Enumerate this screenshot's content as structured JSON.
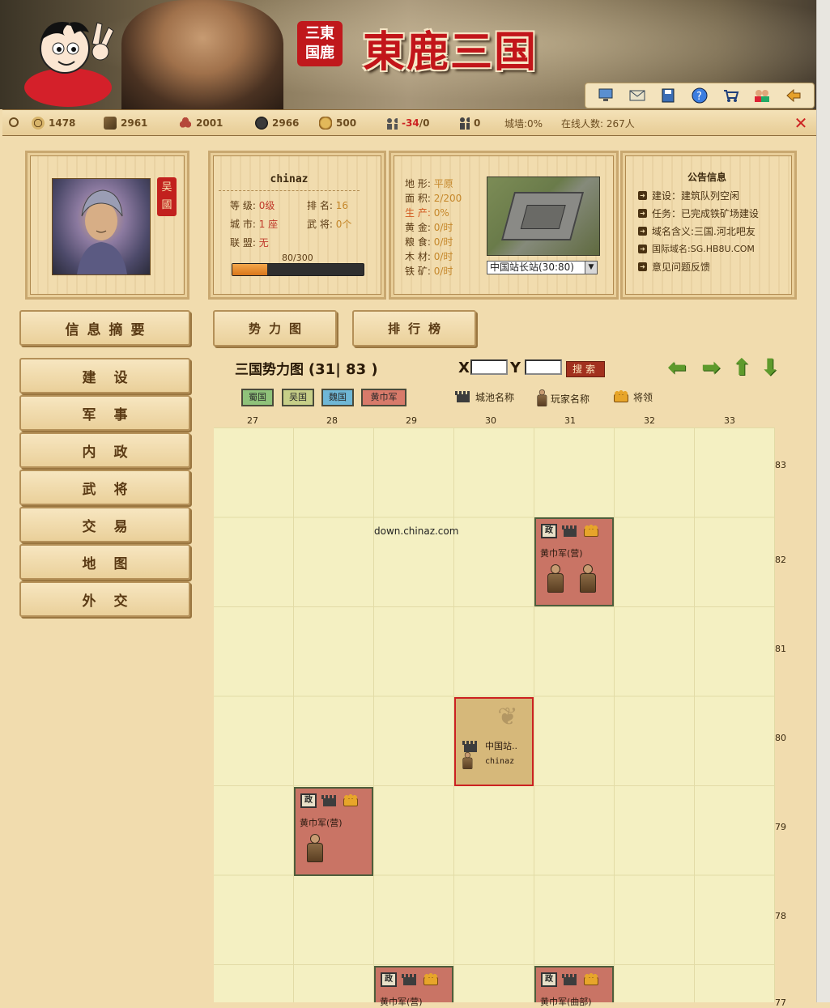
{
  "header": {
    "logo_seal": "三東\n国鹿",
    "logo_title": "東鹿三国",
    "toolbar_icons": [
      "monitor-icon",
      "mail-icon",
      "save-icon",
      "help-icon",
      "shop-cart-icon",
      "friends-icon",
      "exit-icon"
    ]
  },
  "resources": {
    "copper": "1478",
    "wood": "2961",
    "stone": "2001",
    "iron": "2966",
    "food": "500",
    "population_used": "-34",
    "population_sep": "/0",
    "troops": "0",
    "wall_label": "城墙:0%",
    "online_label": "在线人数: 267人"
  },
  "player": {
    "name": "chinaz",
    "kingdom_tag": "吴\n國",
    "level_label": "等 级:",
    "level_value": "0级",
    "rank_label": "排 名:",
    "rank_value": "16",
    "city_label": "城 市:",
    "city_value": "1 座",
    "general_label": "武 将:",
    "general_value": "0个",
    "alliance_label": "联 盟:",
    "alliance_value": "无",
    "exp_text": "80/300",
    "exp_fraction": 0.267
  },
  "city": {
    "terrain_label": "地  形:",
    "terrain_value": "平原",
    "area_label": "面  积:",
    "area_value": "2/200",
    "production_label": "生  产:",
    "production_value": "0%",
    "gold_label": "黄  金:",
    "gold_value": "0/时",
    "grain_label": "粮  食:",
    "grain_value": "0/时",
    "timber_label": "木  材:",
    "timber_value": "0/时",
    "iron_label": "铁  矿:",
    "iron_value": "0/时",
    "city_select": "中国站长站(30:80)"
  },
  "notices": {
    "title": "公告信息",
    "items": [
      "建设：建筑队列空闲",
      "任务：已完成铁矿场建设",
      "域名含义:三国.河北吧友",
      "国际域名:SG.HB8U.COM",
      "意见问题反馈"
    ]
  },
  "menu": {
    "summary": "信息摘要",
    "items": [
      "建设",
      "军事",
      "内政",
      "武将",
      "交易",
      "地图",
      "外交"
    ]
  },
  "tabs": [
    "势力图",
    "排行榜"
  ],
  "map": {
    "title": "三国势力图",
    "coords": "(31| 83 )",
    "x_label": "X",
    "y_label": "Y",
    "search_label": "搜索",
    "factions": [
      {
        "name": "蜀国",
        "color": "#8fc27a"
      },
      {
        "name": "吴国",
        "color": "#c7cf88"
      },
      {
        "name": "魏国",
        "color": "#6fb7d6"
      },
      {
        "name": "黄巾军",
        "color": "#d87a6a"
      }
    ],
    "legend": [
      "城池名称",
      "玩家名称",
      "将领"
    ],
    "columns": [
      "27",
      "28",
      "29",
      "30",
      "31",
      "32",
      "33"
    ],
    "rows": [
      "83",
      "82",
      "81",
      "80",
      "79",
      "78",
      "77"
    ],
    "watermark": "down.chinaz.com",
    "tiles": [
      {
        "name": "黄巾军(营)"
      },
      {
        "name": "黄巾军(营)"
      },
      {
        "name": "黄巾军(营)"
      },
      {
        "name": "黄巾军(曲部)"
      }
    ],
    "home": {
      "city": "中国站..",
      "player": "chinaz"
    }
  },
  "colors": {
    "accent_red": "#c2151a",
    "tile_red": "#c97465",
    "grid_bg": "#f4f0c2"
  }
}
